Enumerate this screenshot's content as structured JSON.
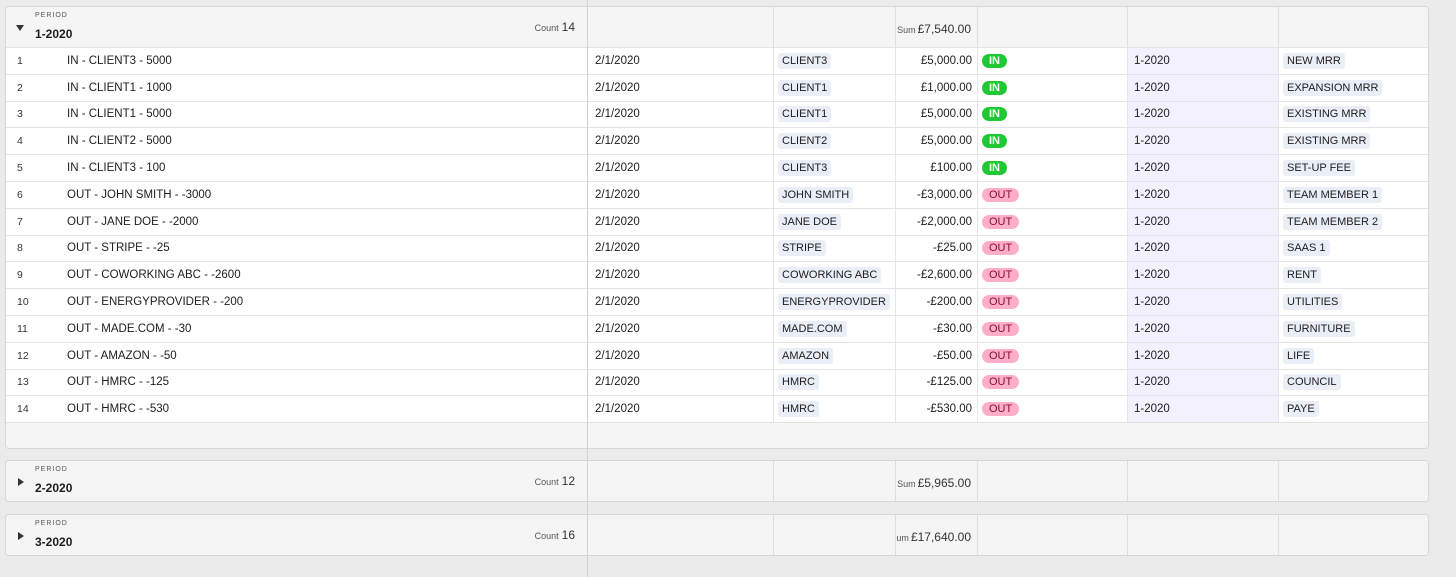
{
  "groups": [
    {
      "period_label": "PERIOD",
      "period": "1-2020",
      "count_label": "Count",
      "count": "14",
      "sum_label": "Sum",
      "sum": "£7,540.00",
      "expanded": true,
      "rows": [
        {
          "n": "1",
          "name": "IN - CLIENT3 - 5000",
          "date": "2/1/2020",
          "who": "CLIENT3",
          "amount": "£5,000.00",
          "type": "IN",
          "period": "1-2020",
          "category": "NEW MRR"
        },
        {
          "n": "2",
          "name": "IN - CLIENT1 - 1000",
          "date": "2/1/2020",
          "who": "CLIENT1",
          "amount": "£1,000.00",
          "type": "IN",
          "period": "1-2020",
          "category": "EXPANSION MRR"
        },
        {
          "n": "3",
          "name": "IN - CLIENT1 - 5000",
          "date": "2/1/2020",
          "who": "CLIENT1",
          "amount": "£5,000.00",
          "type": "IN",
          "period": "1-2020",
          "category": "EXISTING MRR"
        },
        {
          "n": "4",
          "name": "IN - CLIENT2 - 5000",
          "date": "2/1/2020",
          "who": "CLIENT2",
          "amount": "£5,000.00",
          "type": "IN",
          "period": "1-2020",
          "category": "EXISTING MRR"
        },
        {
          "n": "5",
          "name": "IN - CLIENT3 - 100",
          "date": "2/1/2020",
          "who": "CLIENT3",
          "amount": "£100.00",
          "type": "IN",
          "period": "1-2020",
          "category": "SET-UP FEE"
        },
        {
          "n": "6",
          "name": "OUT - JOHN SMITH - -3000",
          "date": "2/1/2020",
          "who": "JOHN SMITH",
          "amount": "-£3,000.00",
          "type": "OUT",
          "period": "1-2020",
          "category": "TEAM MEMBER 1"
        },
        {
          "n": "7",
          "name": "OUT - JANE DOE - -2000",
          "date": "2/1/2020",
          "who": "JANE DOE",
          "amount": "-£2,000.00",
          "type": "OUT",
          "period": "1-2020",
          "category": "TEAM MEMBER 2"
        },
        {
          "n": "8",
          "name": "OUT - STRIPE - -25",
          "date": "2/1/2020",
          "who": "STRIPE",
          "amount": "-£25.00",
          "type": "OUT",
          "period": "1-2020",
          "category": "SAAS 1"
        },
        {
          "n": "9",
          "name": "OUT - COWORKING ABC - -2600",
          "date": "2/1/2020",
          "who": "COWORKING ABC",
          "amount": "-£2,600.00",
          "type": "OUT",
          "period": "1-2020",
          "category": "RENT"
        },
        {
          "n": "10",
          "name": "OUT - ENERGYPROVIDER - -200",
          "date": "2/1/2020",
          "who": "ENERGYPROVIDER",
          "amount": "-£200.00",
          "type": "OUT",
          "period": "1-2020",
          "category": "UTILITIES"
        },
        {
          "n": "11",
          "name": "OUT - MADE.COM - -30",
          "date": "2/1/2020",
          "who": "MADE.COM",
          "amount": "-£30.00",
          "type": "OUT",
          "period": "1-2020",
          "category": "FURNITURE"
        },
        {
          "n": "12",
          "name": "OUT - AMAZON - -50",
          "date": "2/1/2020",
          "who": "AMAZON",
          "amount": "-£50.00",
          "type": "OUT",
          "period": "1-2020",
          "category": "LIFE"
        },
        {
          "n": "13",
          "name": "OUT - HMRC - -125",
          "date": "2/1/2020",
          "who": "HMRC",
          "amount": "-£125.00",
          "type": "OUT",
          "period": "1-2020",
          "category": "COUNCIL"
        },
        {
          "n": "14",
          "name": "OUT - HMRC - -530",
          "date": "2/1/2020",
          "who": "HMRC",
          "amount": "-£530.00",
          "type": "OUT",
          "period": "1-2020",
          "category": "PAYE"
        }
      ]
    },
    {
      "period_label": "PERIOD",
      "period": "2-2020",
      "count_label": "Count",
      "count": "12",
      "sum_label": "Sum",
      "sum": "£5,965.00",
      "expanded": false,
      "rows": []
    },
    {
      "period_label": "PERIOD",
      "period": "3-2020",
      "count_label": "Count",
      "count": "16",
      "sum_label": "Sum",
      "sum": "£17,640.00",
      "expanded": false,
      "rows": []
    }
  ],
  "colors": {
    "in_pill": "#20c933",
    "out_pill": "#ffaec9",
    "period_column": "#f3f1fd",
    "chip": "#e9eef7"
  }
}
